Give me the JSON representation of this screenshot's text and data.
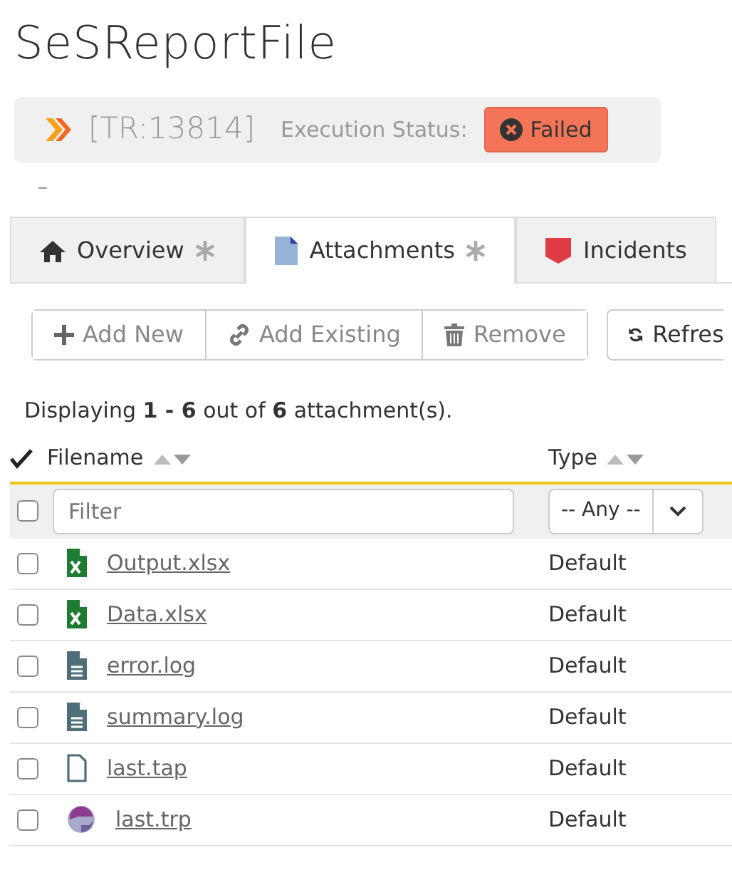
{
  "title": "SeSReportFile",
  "header": {
    "id": "[TR:13814]",
    "status_label": "Execution Status:",
    "status": "Failed",
    "kind": "failed"
  },
  "subtitle": "–",
  "tabs": [
    {
      "label": "Overview",
      "kind": "home",
      "starred": true,
      "selected": false
    },
    {
      "label": "Attachments",
      "kind": "document",
      "starred": true,
      "selected": true
    },
    {
      "label": "Incidents",
      "kind": "incident",
      "starred": false,
      "selected": false
    }
  ],
  "toolbar": [
    {
      "label": "Add New",
      "kind": "add"
    },
    {
      "label": "Add Existing",
      "kind": "link"
    },
    {
      "label": "Remove",
      "kind": "remove"
    }
  ],
  "refresh": {
    "label": "Refres"
  },
  "summary": "Displaying **1 - 6** out of **6** attachment(s).",
  "columns": [
    {
      "label": "Filename"
    },
    {
      "label": "Type"
    }
  ],
  "filter": {
    "placeholder": "Filter",
    "type_value": "-- Any --",
    "all_checked": false
  },
  "rows": [
    {
      "filename": "Output.xlsx",
      "kind": "excel",
      "type": "Default",
      "checked": false
    },
    {
      "filename": "Data.xlsx",
      "kind": "excel",
      "type": "Default",
      "checked": false
    },
    {
      "filename": "error.log",
      "kind": "text",
      "type": "Default",
      "checked": false
    },
    {
      "filename": "summary.log",
      "kind": "text",
      "type": "Default",
      "checked": false
    },
    {
      "filename": "last.tap",
      "kind": "blank",
      "type": "Default",
      "checked": false
    },
    {
      "filename": "last.trp",
      "kind": "report",
      "type": "Default",
      "checked": false
    }
  ]
}
